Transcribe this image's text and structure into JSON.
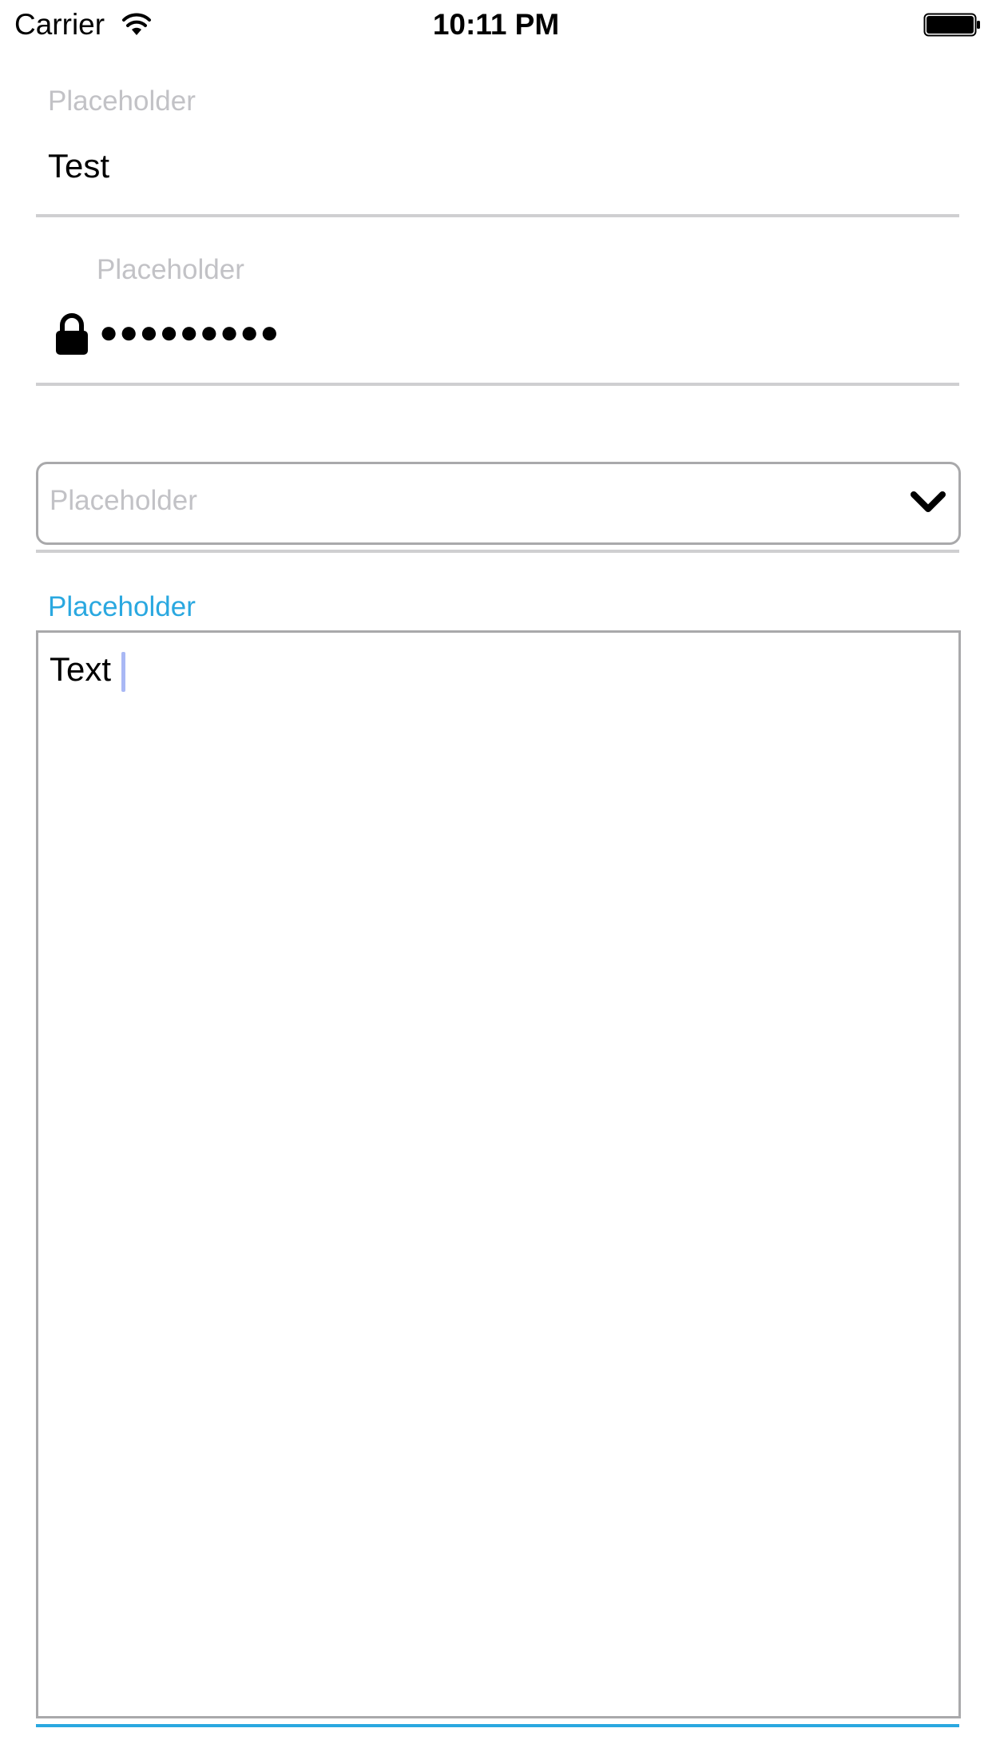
{
  "status_bar": {
    "carrier": "Carrier",
    "time": "10:11 PM",
    "icons": [
      "wifi-icon",
      "battery-icon"
    ]
  },
  "fields": [
    {
      "label": "Placeholder",
      "value": "Test"
    },
    {
      "label": "Placeholder",
      "value": "●●●●●●●●●",
      "icon": "lock-icon"
    }
  ],
  "select": {
    "placeholder": "Placeholder",
    "icon": "chevron-down-icon"
  },
  "textarea": {
    "label": "Placeholder",
    "value": "Text"
  },
  "colors": {
    "accent": "#2aa8e0",
    "placeholder": "#c2c2c6",
    "underline": "#cfcfd1",
    "border": "#a9a9ab",
    "caret": "#a9b8f5"
  }
}
